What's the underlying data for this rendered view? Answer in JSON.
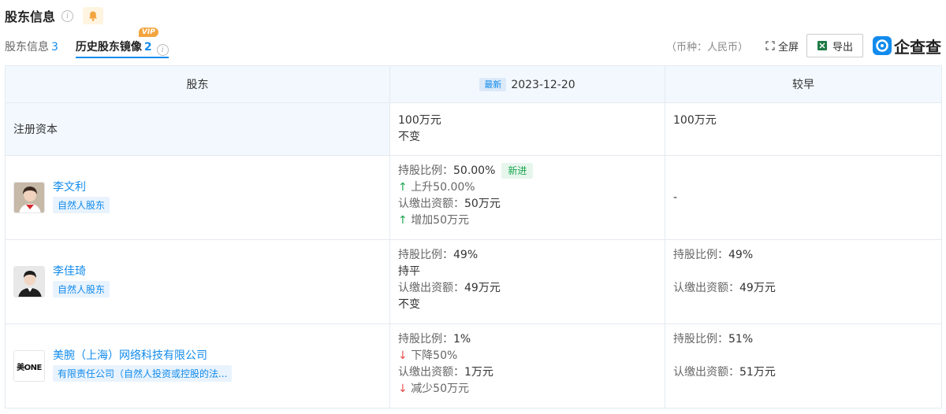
{
  "header": {
    "title": "股东信息"
  },
  "tabs": [
    {
      "label": "股东信息",
      "count": "3"
    },
    {
      "label": "历史股东镜像",
      "count": "2",
      "badge": "VIP"
    }
  ],
  "toolbar": {
    "currency": "（币种：人民币）",
    "fullscreen": "全屏",
    "export": "导出",
    "logo": "企查查"
  },
  "table": {
    "col_shareholder": "股东",
    "latest_badge": "最新",
    "latest_date": "2023-12-20",
    "col_earlier": "较早",
    "capital": {
      "label": "注册资本",
      "latest": "100万元",
      "latest_change": "不变",
      "earlier": "100万元"
    },
    "rows": [
      {
        "name": "李文利",
        "type": "自然人股东",
        "latest": {
          "ratio_label": "持股比例：",
          "ratio": "50.00%",
          "status_tag": "新进",
          "ratio_change": "上升50.00%",
          "amount_label": "认缴出资额：",
          "amount": "50万元",
          "amount_change": "增加50万元"
        },
        "earlier": {
          "placeholder": "-"
        }
      },
      {
        "name": "李佳琦",
        "type": "自然人股东",
        "latest": {
          "ratio_label": "持股比例：",
          "ratio": "49%",
          "ratio_change": "持平",
          "amount_label": "认缴出资额：",
          "amount": "49万元",
          "amount_change": "不变"
        },
        "earlier": {
          "ratio_label": "持股比例：",
          "ratio": "49%",
          "amount_label": "认缴出资额：",
          "amount": "49万元"
        }
      },
      {
        "name": "美腕（上海）网络科技有限公司",
        "type": "有限责任公司（自然人投资或控股的法...",
        "logo_text": "美ONE",
        "latest": {
          "ratio_label": "持股比例：",
          "ratio": "1%",
          "ratio_change": "下降50%",
          "amount_label": "认缴出资额：",
          "amount": "1万元",
          "amount_change": "减少50万元"
        },
        "earlier": {
          "ratio_label": "持股比例：",
          "ratio": "51%",
          "amount_label": "认缴出资额：",
          "amount": "51万元"
        }
      }
    ]
  },
  "colors": {
    "accent": "#128bed",
    "up": "#19a64d",
    "down": "#ea4f4f",
    "header_bg": "#f2f8fe"
  }
}
